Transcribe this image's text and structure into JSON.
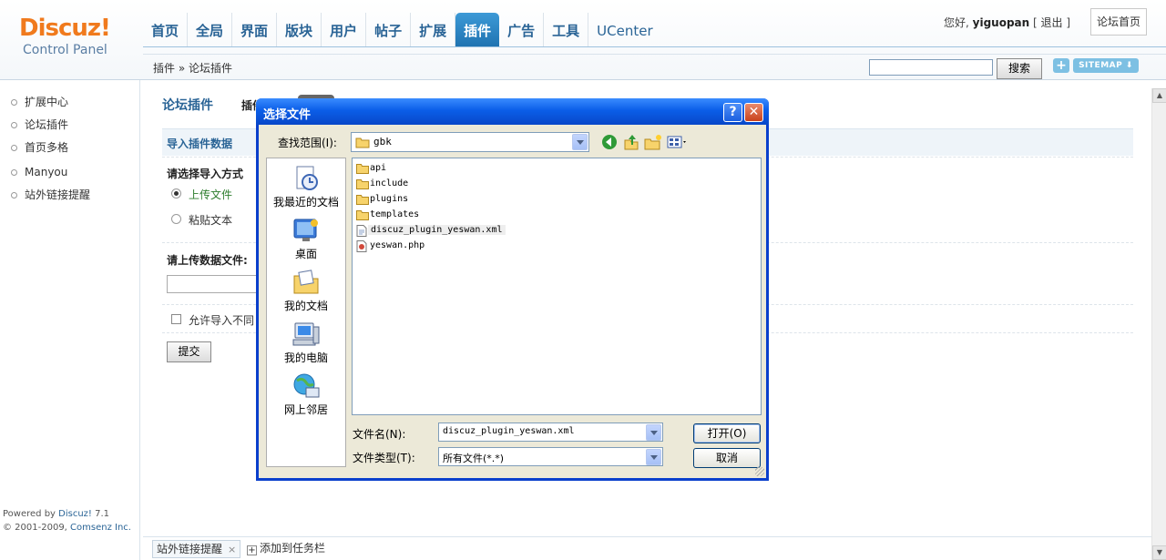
{
  "logo": {
    "brand": "Discuz!",
    "sub": "Control Panel"
  },
  "nav": {
    "tabs": [
      {
        "label": "首页"
      },
      {
        "label": "全局"
      },
      {
        "label": "界面"
      },
      {
        "label": "版块"
      },
      {
        "label": "用户"
      },
      {
        "label": "帖子"
      },
      {
        "label": "扩展"
      },
      {
        "label": "插件",
        "active": true
      },
      {
        "label": "广告"
      },
      {
        "label": "工具"
      },
      {
        "label": "UCenter"
      }
    ]
  },
  "user": {
    "greeting": "您好,",
    "name": "yiguopan",
    "bracket_open": "[",
    "logout": "退出",
    "bracket_close": "]",
    "forum_home": "论坛首页"
  },
  "breadcrumb": {
    "text": "插件 » 论坛插件"
  },
  "search": {
    "value": "",
    "button": "搜索"
  },
  "sitemap": {
    "label": "SITEMAP",
    "plus": "+"
  },
  "sidebar": {
    "items": [
      {
        "label": "扩展中心"
      },
      {
        "label": "论坛插件"
      },
      {
        "label": "首页多格"
      },
      {
        "label": "Manyou"
      },
      {
        "label": "站外链接提醒"
      }
    ],
    "powered_prefix": "Powered by ",
    "powered_brand": "Discuz!",
    "powered_version": " 7.1",
    "copyright_prefix": "© 2001-2009, ",
    "copyright_brand": "Comsenz Inc."
  },
  "main": {
    "title": "论坛插件",
    "tab": "插件",
    "section_title": "导入插件数据",
    "import_method_label": "请选择导入方式",
    "radio_upload": "上传文件",
    "radio_paste": "粘贴文本",
    "upload_label": "请上传数据文件:",
    "checkbox_label": "允许导入不同",
    "submit": "提交"
  },
  "taskbar": {
    "item": "站外链接提醒",
    "close": "×",
    "add": "添加到任务栏",
    "add_icon": "+"
  },
  "dialog": {
    "title": "选择文件",
    "help": "?",
    "close": "✕",
    "lookin_label": "查找范围(I):",
    "lookin_value": "gbk",
    "places": [
      {
        "label": "我最近的文档",
        "icon": "recent-documents-icon"
      },
      {
        "label": "桌面",
        "icon": "desktop-icon"
      },
      {
        "label": "我的文档",
        "icon": "my-documents-icon"
      },
      {
        "label": "我的电脑",
        "icon": "my-computer-icon"
      },
      {
        "label": "网上邻居",
        "icon": "network-places-icon"
      }
    ],
    "files": [
      {
        "name": "api",
        "type": "folder"
      },
      {
        "name": "include",
        "type": "folder"
      },
      {
        "name": "plugins",
        "type": "folder"
      },
      {
        "name": "templates",
        "type": "folder"
      },
      {
        "name": "discuz_plugin_yeswan.xml",
        "type": "xml",
        "selected": true
      },
      {
        "name": "yeswan.php",
        "type": "php"
      }
    ],
    "filename_label": "文件名(N):",
    "filename_value": "discuz_plugin_yeswan.xml",
    "filetype_label": "文件类型(T):",
    "filetype_value": "所有文件(*.*)",
    "open": "打开(O)",
    "cancel": "取消"
  },
  "colors": {
    "accent": "#2a6496",
    "logo_orange": "#f07a1d",
    "xp_blue": "#0b5ee8",
    "dialog_bg": "#ece9d8"
  }
}
